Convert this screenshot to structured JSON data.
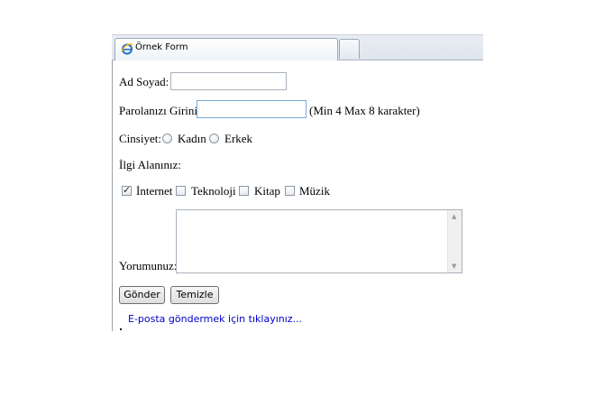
{
  "browser": {
    "tab_title": "Örnek Form",
    "tab_icon": "ie-icon",
    "new_tab_icon": "new-tab-icon"
  },
  "form": {
    "name_label": "Ad Soyad:",
    "name_value": "",
    "password_label": "Parolanızı Giriniz",
    "password_value": "",
    "password_hint": "(Min 4 Max 8 karakter)",
    "gender_label": "Cinsiyet:",
    "gender_options": [
      {
        "label": "Kadın",
        "selected": false
      },
      {
        "label": "Erkek",
        "selected": false
      }
    ],
    "interests_label": "İlgi Alanınız:",
    "interests": [
      {
        "label": "İnternet",
        "checked": true
      },
      {
        "label": "Teknoloji",
        "checked": false
      },
      {
        "label": "Kitap",
        "checked": false
      },
      {
        "label": "Müzik",
        "checked": false
      }
    ],
    "comment_label": "Yorumunuz:",
    "comment_value": "",
    "submit_label": "Gönder",
    "reset_label": "Temizle",
    "email_link": "E-posta göndermek için tıklayınız..."
  },
  "colors": {
    "link": "#0000cc",
    "focus_border": "#7aa7d6"
  }
}
